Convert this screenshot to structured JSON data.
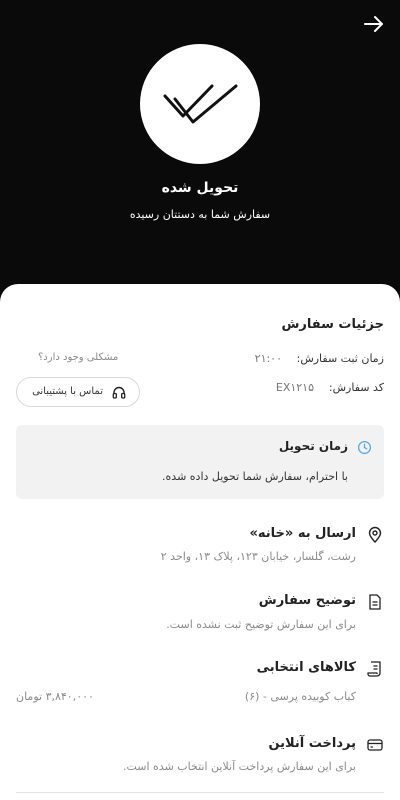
{
  "header": {
    "title": "تحویل شده",
    "subtitle": "سفارش شما به دستتان رسیده"
  },
  "details": {
    "section_title": "جزئیات سفارش",
    "time_label": "زمان ثبت سفارش:",
    "time_value": "۲۱:۰۰",
    "code_label": "کد سفارش:",
    "code_value": "EX۱۲۱۵",
    "problem_text": "مشکلی وجود دارد؟",
    "support_label": "تماس با پشتیبانی"
  },
  "delivery": {
    "title": "زمان تحویل",
    "message": "با احترام، سفارش شما تحویل داده شده."
  },
  "shipping": {
    "title": "ارسال به «خانه»",
    "address": "رشت، گلسار، خیابان ۱۲۳، پلاک ۱۳، واحد ۲"
  },
  "note": {
    "title": "توضیح سفارش",
    "text": "برای این سفارش توضیح ثبت نشده است."
  },
  "items": {
    "title": "کالاهای انتخابی",
    "list": [
      {
        "name": "کباب کوبیده پرسی - (۶)",
        "price": "۳,۸۴۰,۰۰۰ تومان"
      }
    ]
  },
  "payment": {
    "title": "پرداخت آنلاین",
    "text": "برای این سفارش پرداخت آنلاین انتخاب شده است."
  },
  "colors": {
    "background": "#0a0a0a",
    "sheet": "#ffffff",
    "delivery_box": "#f2f2f2",
    "clock_accent": "#5aa9e6"
  },
  "icons": {
    "back": "arrow-right-icon",
    "status": "double-check-icon",
    "support": "headset-icon",
    "delivery": "clock-icon",
    "shipping": "location-pin-icon",
    "note": "document-icon",
    "items": "receipt-icon",
    "payment": "credit-card-icon"
  }
}
